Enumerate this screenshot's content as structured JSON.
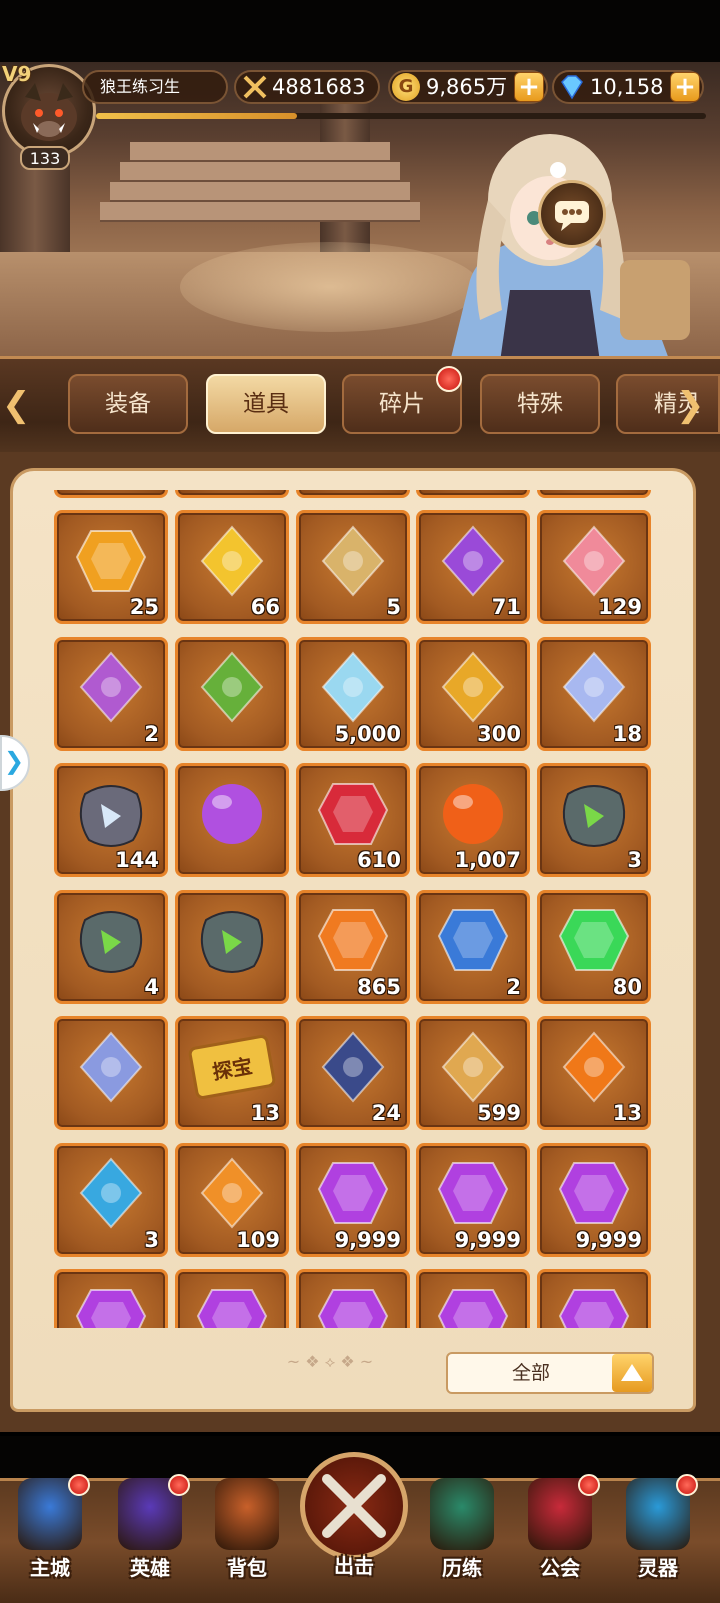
{
  "player": {
    "vip": "V9",
    "level": "133",
    "name": "狼王练习生",
    "power": "4881683",
    "gold": "9,865万",
    "gems": "10,158",
    "xp_progress": 0.33
  },
  "tabs": [
    {
      "label": "装备",
      "active": false
    },
    {
      "label": "道具",
      "active": true
    },
    {
      "label": "碎片",
      "active": false,
      "badge": true
    },
    {
      "label": "特殊",
      "active": false
    },
    {
      "label": "精灵",
      "active": false
    }
  ],
  "items": [
    {
      "icon": "sun-shard-icon",
      "count": "25",
      "color": "#f0a020"
    },
    {
      "icon": "gold-ingot-icon",
      "count": "66",
      "color": "#f3c42e"
    },
    {
      "icon": "blueprint-gear-icon",
      "count": "5",
      "color": "#d9b36a"
    },
    {
      "icon": "purple-potion-icon",
      "count": "71",
      "color": "#9a4ad8"
    },
    {
      "icon": "pink-lotus-icon",
      "count": "129",
      "color": "#f08a9a"
    },
    {
      "icon": "purple-hourglass-icon",
      "count": "2",
      "color": "#b05ad0"
    },
    {
      "icon": "green-hourglass-icon",
      "count": "",
      "color": "#66b03a"
    },
    {
      "icon": "rainbow-star-icon",
      "count": "5,000",
      "color": "#9ad8f0"
    },
    {
      "icon": "amber-flask-icon",
      "count": "300",
      "color": "#e8a828"
    },
    {
      "icon": "blue-feather-icon",
      "count": "18",
      "color": "#a8b8f0"
    },
    {
      "icon": "rune-stone-white-icon",
      "count": "144",
      "color": "#6a6a7a"
    },
    {
      "icon": "purple-orb-icon",
      "count": "",
      "color": "#b050e0"
    },
    {
      "icon": "red-crystal-icon",
      "count": "610",
      "color": "#d82a3a"
    },
    {
      "icon": "fire-orb-icon",
      "count": "1,007",
      "color": "#f06018"
    },
    {
      "icon": "rune-stone-green-boot-icon",
      "count": "3",
      "color": "#5a6a6a"
    },
    {
      "icon": "rune-stone-green-star-icon",
      "count": "4",
      "color": "#5a6a6a"
    },
    {
      "icon": "rune-stone-green-glyph-icon",
      "count": "",
      "color": "#5a6a6a"
    },
    {
      "icon": "orange-gem-icon",
      "count": "865",
      "color": "#f07a20"
    },
    {
      "icon": "crystal-ball-icon",
      "count": "2",
      "color": "#3a7ad8"
    },
    {
      "icon": "green-gem-icon",
      "count": "80",
      "color": "#3ad858"
    },
    {
      "icon": "blue-key-icon",
      "count": "",
      "color": "#8a9ae0"
    },
    {
      "icon": "treasure-ticket-icon",
      "count": "13",
      "color": "#f0c040",
      "text": "探宝"
    },
    {
      "icon": "telescope-icon",
      "count": "24",
      "color": "#3a4a8a"
    },
    {
      "icon": "cannon-icon",
      "count": "599",
      "color": "#e0a850"
    },
    {
      "icon": "flame-helm-icon",
      "count": "13",
      "color": "#f07818"
    },
    {
      "icon": "water-sprout-icon",
      "count": "3",
      "color": "#38a8e0"
    },
    {
      "icon": "orange-vial-icon",
      "count": "109",
      "color": "#f09028"
    },
    {
      "icon": "purple-crystal-icon",
      "count": "9,999",
      "color": "#b040e0"
    },
    {
      "icon": "purple-crystal-icon",
      "count": "9,999",
      "color": "#b040e0"
    },
    {
      "icon": "purple-crystal-icon",
      "count": "9,999",
      "color": "#b040e0"
    },
    {
      "icon": "purple-crystal-icon",
      "count": "",
      "color": "#b040e0"
    },
    {
      "icon": "purple-crystal-icon",
      "count": "",
      "color": "#b040e0"
    },
    {
      "icon": "purple-crystal-icon",
      "count": "",
      "color": "#b040e0"
    },
    {
      "icon": "purple-crystal-icon",
      "count": "",
      "color": "#b040e0"
    },
    {
      "icon": "purple-crystal-icon",
      "count": "",
      "color": "#b040e0"
    }
  ],
  "filter": {
    "label": "全部"
  },
  "nav": [
    {
      "label": "主城",
      "icon": "castle-icon",
      "badge": true
    },
    {
      "label": "英雄",
      "icon": "helmet-icon",
      "badge": true
    },
    {
      "label": "背包",
      "icon": "backpack-icon",
      "badge": false
    },
    {
      "label": "出击",
      "icon": "crossed-swords-icon",
      "badge": false
    },
    {
      "label": "历练",
      "icon": "dragon-icon",
      "badge": false
    },
    {
      "label": "公会",
      "icon": "guild-banner-icon",
      "badge": true
    },
    {
      "label": "灵器",
      "icon": "spirit-orb-icon",
      "badge": true
    }
  ]
}
